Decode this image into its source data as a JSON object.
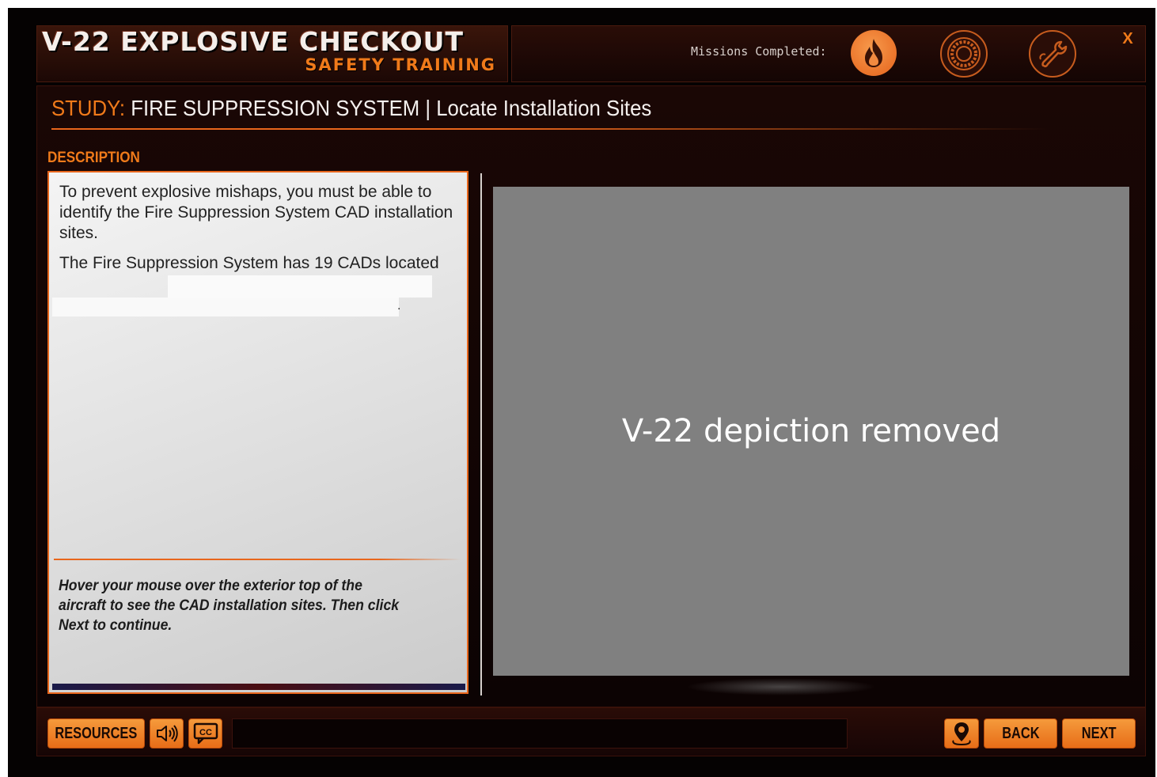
{
  "header": {
    "title": "V-22 EXPLOSIVE CHECKOUT",
    "subtitle": "SAFETY TRAINING",
    "missions_label": "Missions Completed:",
    "close_label": "X",
    "badges": [
      "fire-icon",
      "ring-icon",
      "wrench-icon"
    ]
  },
  "study": {
    "prefix": "STUDY:",
    "title": "FIRE SUPPRESSION SYSTEM | Locate Installation Sites"
  },
  "description": {
    "label": "DESCRIPTION",
    "paragraph1": "To prevent explosive mishaps, you must be able to identify the Fire Suppression System CAD installation sites.",
    "paragraph2": "The Fire Suppression System has 19 CADs located",
    "trailing_punct": ".",
    "instruction": "Hover your mouse over the exterior top of the aircraft to see the CAD installation sites. Then click Next to continue."
  },
  "image_panel": {
    "placeholder_text": "V-22 depiction removed"
  },
  "toolbar": {
    "resources_label": "RESOURCES",
    "audio_icon": "speaker-icon",
    "cc_label": "CC",
    "caption_text": "",
    "map_icon": "map-pin-icon",
    "back_label": "BACK",
    "next_label": "NEXT"
  },
  "colors": {
    "accent": "#f07a1a",
    "background": "#050202",
    "panel": "#1a0705",
    "card": "#e6e6e6",
    "placeholder": "#808080"
  }
}
